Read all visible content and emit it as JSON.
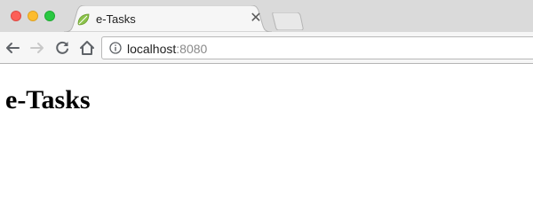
{
  "tab": {
    "title": "e-Tasks",
    "close_glyph": "✕",
    "favicon": "spring-leaf-icon"
  },
  "address_bar": {
    "host": "localhost",
    "port": ":8080",
    "security_icon": "info-icon"
  },
  "toolbar": {
    "back_icon": "back-arrow-icon",
    "forward_icon": "forward-arrow-icon",
    "reload_icon": "reload-icon",
    "home_icon": "home-icon"
  },
  "page": {
    "heading": "e-Tasks"
  },
  "colors": {
    "close": "#fc5f57",
    "minimize": "#fdbc2e",
    "zoom": "#29c841",
    "favicon": "#8bc34a"
  }
}
